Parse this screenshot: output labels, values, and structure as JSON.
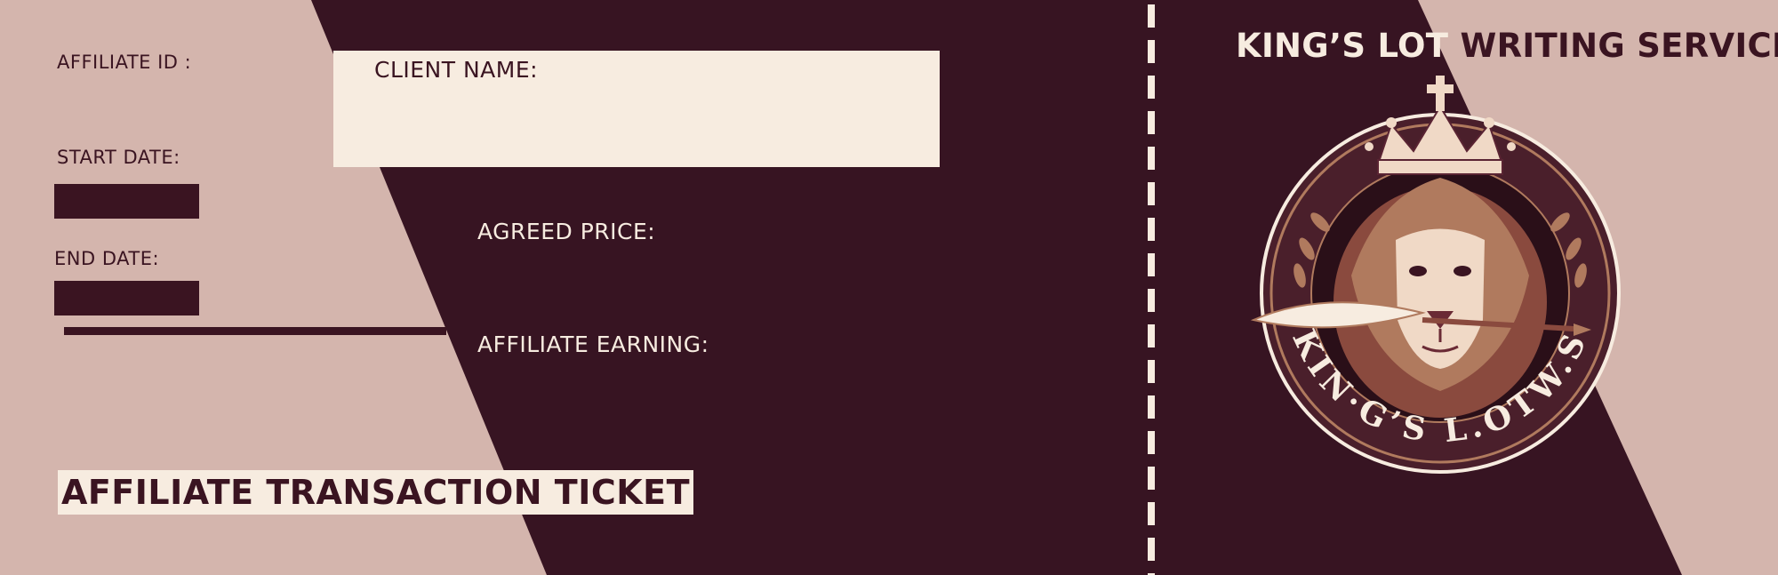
{
  "colors": {
    "background_rose": "#d4b5ad",
    "plum": "#371422",
    "dark_field": "#3a1421",
    "cream": "#f7ece0",
    "emblem_bronze": "#b07a5e"
  },
  "fields": {
    "affiliate_id_label": "AFFILIATE ID :",
    "client_name_label": "CLIENT NAME:",
    "start_date_label": "START DATE:",
    "end_date_label": "END DATE:",
    "agreed_price_label": "AGREED PRICE:",
    "affiliate_earning_label": "AFFILIATE EARNING:"
  },
  "ticket_title": "AFFILIATE TRANSACTION TICKET",
  "brand": {
    "part1": "KING’S LOT ",
    "part2": "WRITING SERVICE"
  },
  "emblem": {
    "icon": "lion-crest-icon",
    "ring_text": "KIN·G’S L.OTW.S"
  }
}
